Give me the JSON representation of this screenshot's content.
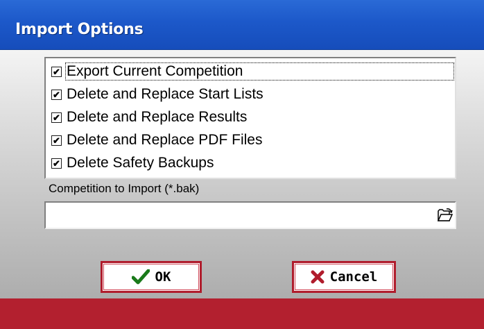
{
  "window": {
    "title": "Import Options"
  },
  "options": [
    {
      "label": "Export Current Competition",
      "checked": true,
      "focused": true
    },
    {
      "label": "Delete and Replace Start Lists",
      "checked": true
    },
    {
      "label": "Delete and Replace Results",
      "checked": true
    },
    {
      "label": "Delete and Replace PDF Files",
      "checked": true
    },
    {
      "label": "Delete Safety Backups",
      "checked": true
    }
  ],
  "import_field": {
    "label": "Competition to Import (*.bak)",
    "value": "",
    "browse_icon": "folder-open-icon"
  },
  "buttons": {
    "ok": {
      "label": "OK",
      "icon": "checkmark-icon",
      "icon_color": "#1a7a1a"
    },
    "cancel": {
      "label": "Cancel",
      "icon": "x-icon",
      "icon_color": "#b01c2c"
    }
  },
  "colors": {
    "titlebar": "#1c58c9",
    "accent_red": "#b3202f"
  }
}
